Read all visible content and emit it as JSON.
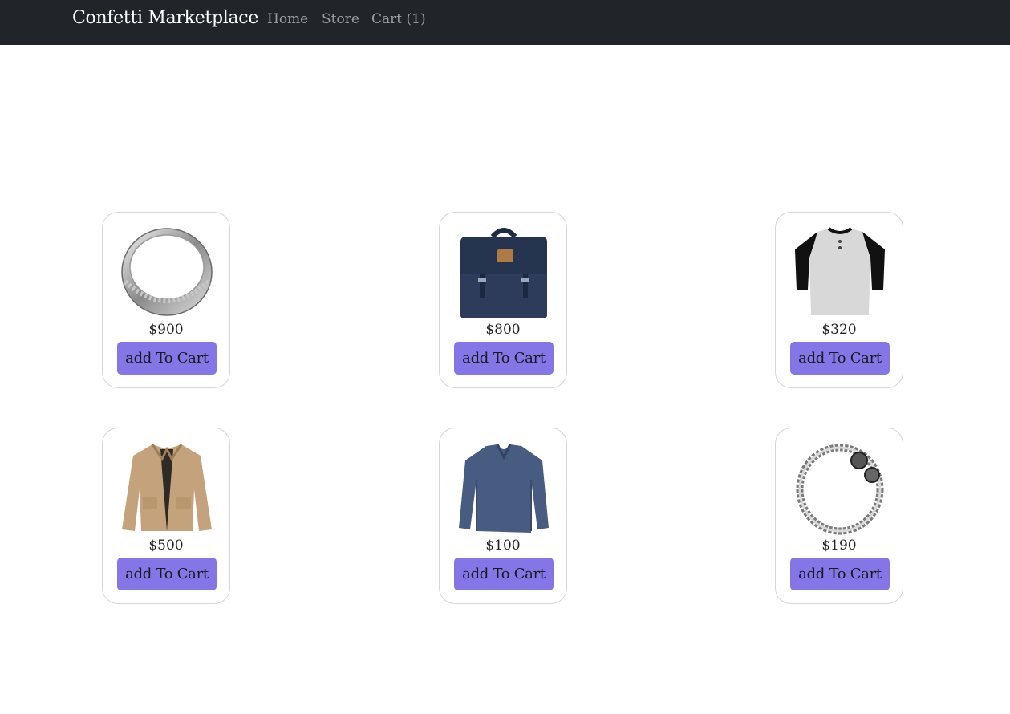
{
  "navbar": {
    "brand": "Confetti Marketplace",
    "links": [
      "Home",
      "Store",
      "Cart (1)"
    ],
    "background": "#212529"
  },
  "products": [
    {
      "price": "$900",
      "button_label": "add To Cart",
      "icon": "ring-icon"
    },
    {
      "price": "$800",
      "button_label": "add To Cart",
      "icon": "backpack-icon"
    },
    {
      "price": "$320",
      "button_label": "add To Cart",
      "icon": "shirt-icon"
    },
    {
      "price": "$500",
      "button_label": "add To Cart",
      "icon": "jacket-icon"
    },
    {
      "price": "$100",
      "button_label": "add To Cart",
      "icon": "sweater-icon"
    },
    {
      "price": "$190",
      "button_label": "add To Cart",
      "icon": "bracelet-icon"
    }
  ],
  "colors": {
    "button": "#8576e8",
    "card_border": "#d6d6d6"
  }
}
